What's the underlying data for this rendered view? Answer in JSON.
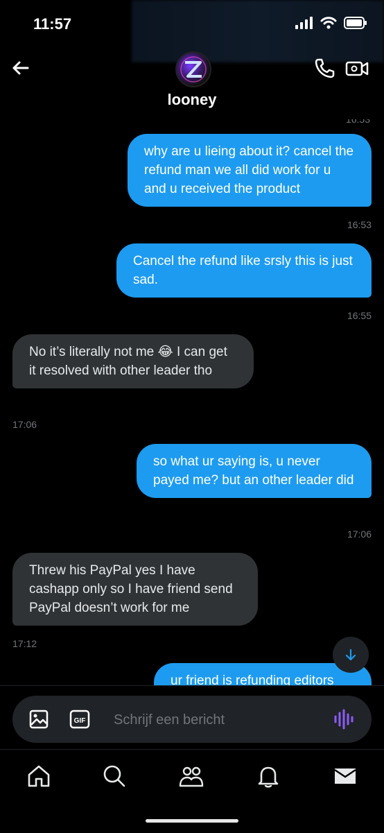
{
  "status_bar": {
    "time": "11:57"
  },
  "header": {
    "contact_name": "looney",
    "back_icon": "arrow-left-icon",
    "call_icon": "phone-icon",
    "video_icon": "video-camera-icon"
  },
  "messages": {
    "previous_timestamp": "16:53",
    "items": [
      {
        "direction": "out",
        "text": "why are u lieing about it? cancel the refund man we all did work for u and u received the product",
        "time": "16:53"
      },
      {
        "direction": "out",
        "text": "Cancel the refund like srsly this is just sad.",
        "time": "16:55"
      },
      {
        "direction": "in",
        "text": "No it’s literally not me 😂 I can get it resolved with other leader tho",
        "time": "17:06"
      },
      {
        "direction": "out",
        "text": "so what ur saying is, u never payed me? but an other leader did",
        "time": "17:06"
      },
      {
        "direction": "in",
        "text": "Threw his PayPal yes I have cashapp only so I have friend send PayPal doesn’t work for me",
        "time": "17:12"
      },
      {
        "direction": "out",
        "text": "ur friend is refunding editors",
        "time": ""
      }
    ]
  },
  "compose": {
    "placeholder": "Schrijf een bericht",
    "image_icon": "image-icon",
    "gif_label": "GIF",
    "voice_icon": "voice-wave-icon"
  },
  "tabbar": {
    "items": [
      "home-icon",
      "search-icon",
      "communities-icon",
      "notifications-icon",
      "messages-icon"
    ]
  },
  "colors": {
    "accent": "#1d9bf0",
    "incoming": "#2f3336",
    "voice": "#8b5cf6"
  }
}
